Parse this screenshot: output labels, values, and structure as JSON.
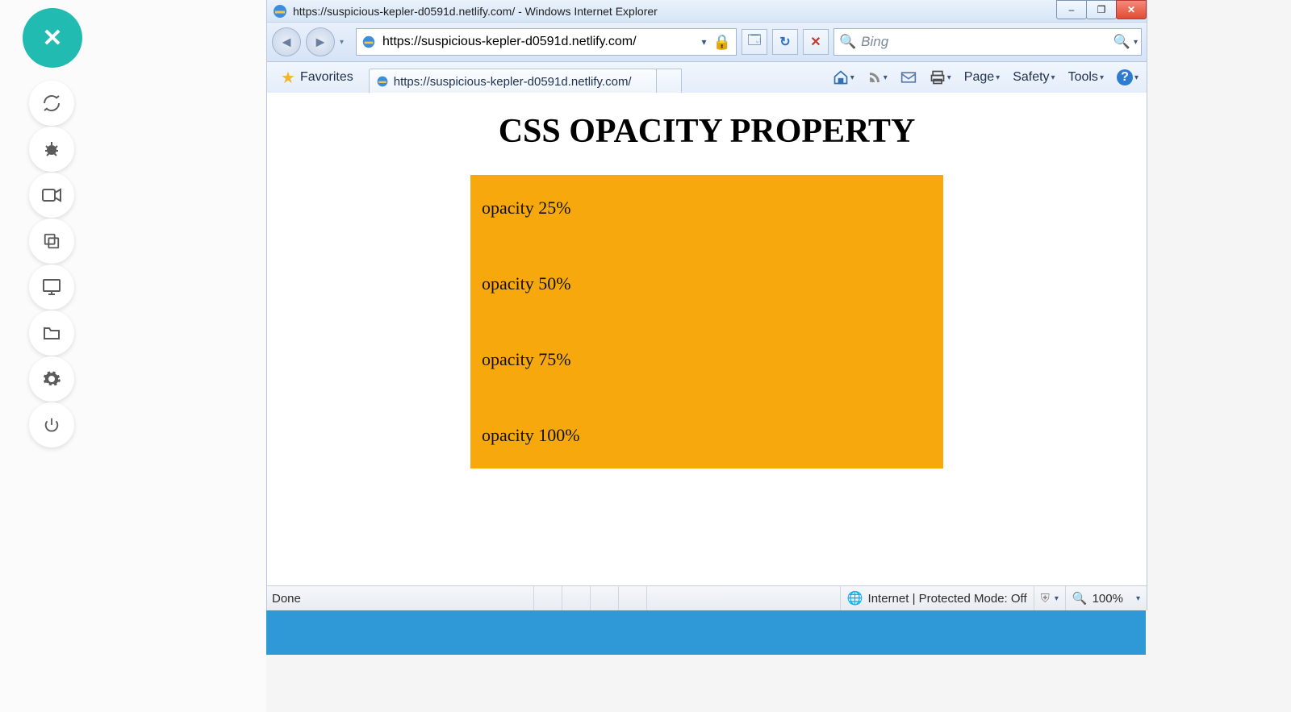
{
  "sidebar": {
    "close_icon": "✕",
    "icons": [
      "sync",
      "bug",
      "video",
      "copy",
      "monitor",
      "folder",
      "gear",
      "power"
    ]
  },
  "window": {
    "title": "https://suspicious-kepler-d0591d.netlify.com/ - Windows Internet Explorer",
    "buttons": {
      "min": "–",
      "max": "❐",
      "close": "✕"
    }
  },
  "nav": {
    "address_value": "https://suspicious-kepler-d0591d.netlify.com/",
    "dropdown_caret": "▾",
    "lock_icon": "🔒",
    "compat_icon": "🗔",
    "refresh_icon": "↻",
    "stop_icon": "✕",
    "search_placeholder": "Bing",
    "search_icon": "🔍"
  },
  "tabs": {
    "favorites_label": "Favorites",
    "active_tab_label": "https://suspicious-kepler-d0591d.netlify.com/"
  },
  "commandbar": {
    "home": "🏠",
    "feeds": "📰",
    "mail": "✉",
    "print": "🖶",
    "page_label": "Page",
    "safety_label": "Safety",
    "tools_label": "Tools",
    "help_icon": "?"
  },
  "page": {
    "heading": "CSS OPACITY PROPERTY",
    "lines": [
      "opacity 25%",
      "opacity 50%",
      "opacity 75%",
      "opacity 100%"
    ],
    "box_color": "#f6a80c"
  },
  "status": {
    "done": "Done",
    "zone": "Internet | Protected Mode: Off",
    "zoom": "100%"
  }
}
